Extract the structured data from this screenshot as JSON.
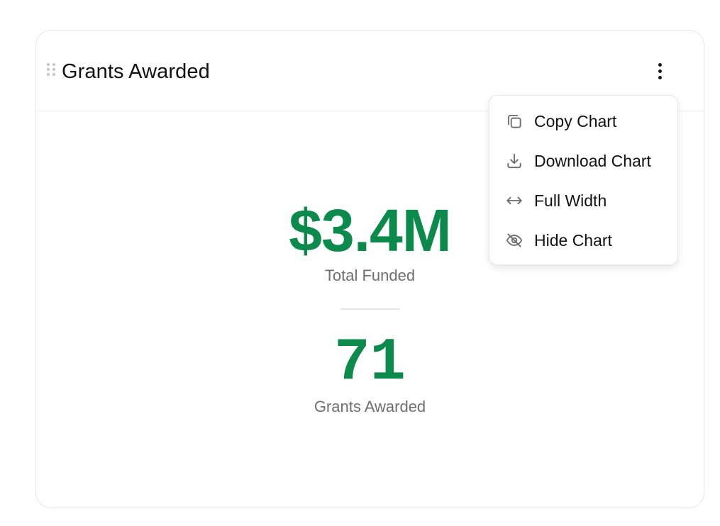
{
  "card": {
    "title": "Grants Awarded",
    "metrics": [
      {
        "value": "$3.4M",
        "label": "Total Funded"
      },
      {
        "value": "71",
        "label": "Grants Awarded"
      }
    ]
  },
  "menu": {
    "items": [
      {
        "label": "Copy Chart",
        "icon": "copy-icon"
      },
      {
        "label": "Download Chart",
        "icon": "download-icon"
      },
      {
        "label": "Full Width",
        "icon": "arrows-horizontal-icon"
      },
      {
        "label": "Hide Chart",
        "icon": "eye-off-icon"
      }
    ]
  },
  "colors": {
    "accent": "#0b8a4c",
    "label": "#6f6f6f",
    "icon": "#6b6b6b"
  }
}
